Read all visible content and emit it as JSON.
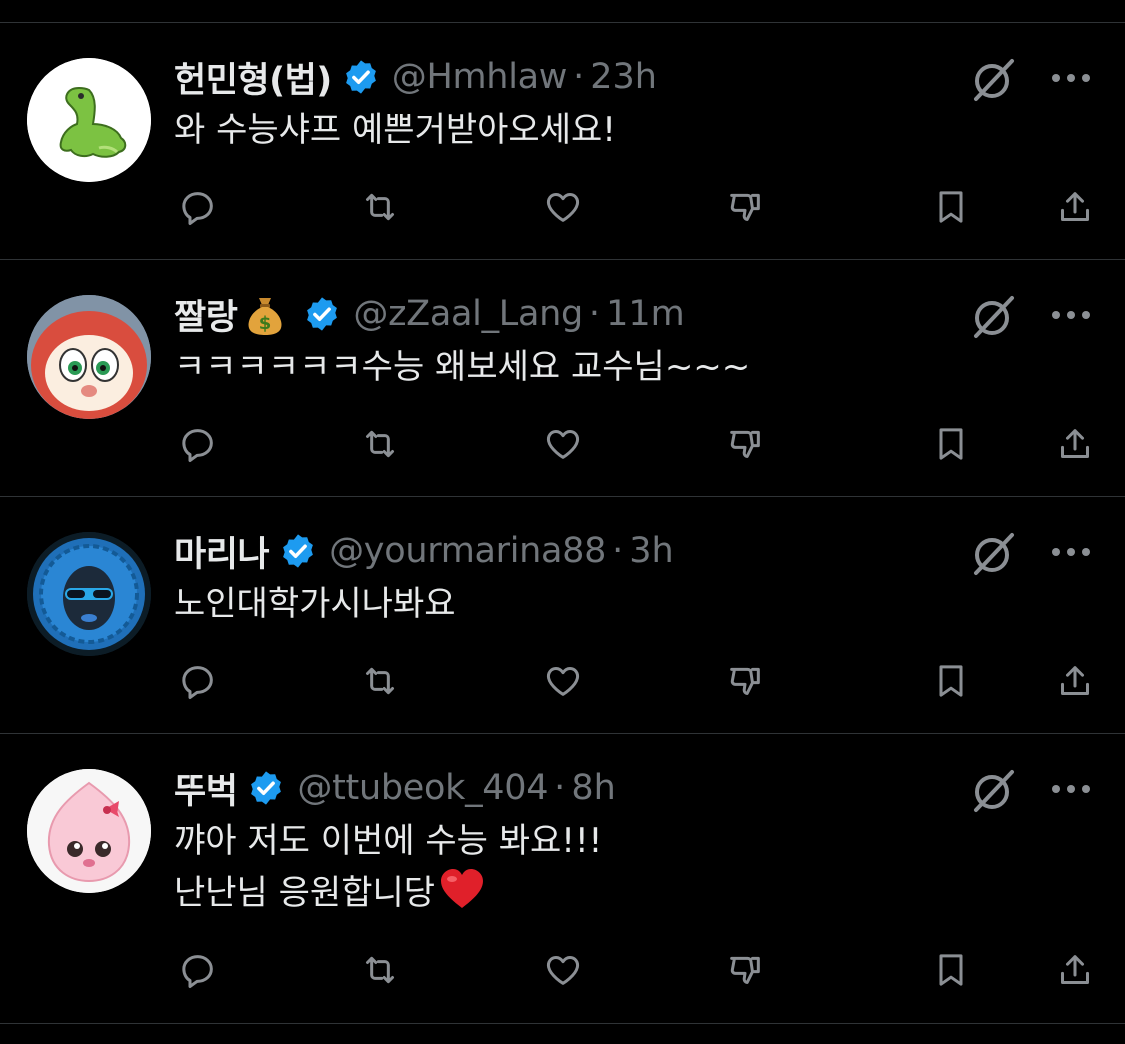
{
  "colors": {
    "background": "#000000",
    "text_primary": "#e7e9ea",
    "text_secondary": "#71767b",
    "divider": "#2f3336",
    "verified_blue": "#1d9bf0"
  },
  "replies": [
    {
      "display_name": "헌민형(법)",
      "name_emoji": "",
      "verified": true,
      "handle": "@Hmhlaw",
      "separator": "·",
      "time": "23h",
      "text": "와 수능샤프 예쁜거받아오세요!",
      "avatar_icon": "green-dinosaur-avatar"
    },
    {
      "display_name": "짤랑",
      "name_emoji": "money-bag-emoji",
      "verified": true,
      "handle": "@zZaal_Lang",
      "separator": "·",
      "time": "11m",
      "text": "ㅋㅋㅋㅋㅋㅋ수능 왜보세요 교수님~~~",
      "avatar_icon": "red-cartoon-character-avatar"
    },
    {
      "display_name": "마리나",
      "name_emoji": "",
      "verified": true,
      "handle": "@yourmarina88",
      "separator": "·",
      "time": "3h",
      "text": "노인대학가시나봐요",
      "avatar_icon": "blue-bonnet-portrait-avatar"
    },
    {
      "display_name": "뚜벅",
      "name_emoji": "",
      "verified": true,
      "handle": "@ttubeok_404",
      "separator": "·",
      "time": "8h",
      "text_line1": "꺄아 저도 이번에 수능 봐요!!!",
      "text_line2": "난난님 응원합니당",
      "text_emoji": "red-heart-emoji",
      "avatar_icon": "pink-peach-character-avatar"
    }
  ],
  "action_icons": [
    "reply-icon",
    "repost-icon",
    "like-icon",
    "dislike-icon",
    "bookmark-icon",
    "share-icon"
  ],
  "menu_icons": [
    "grok-icon",
    "more-icon"
  ]
}
